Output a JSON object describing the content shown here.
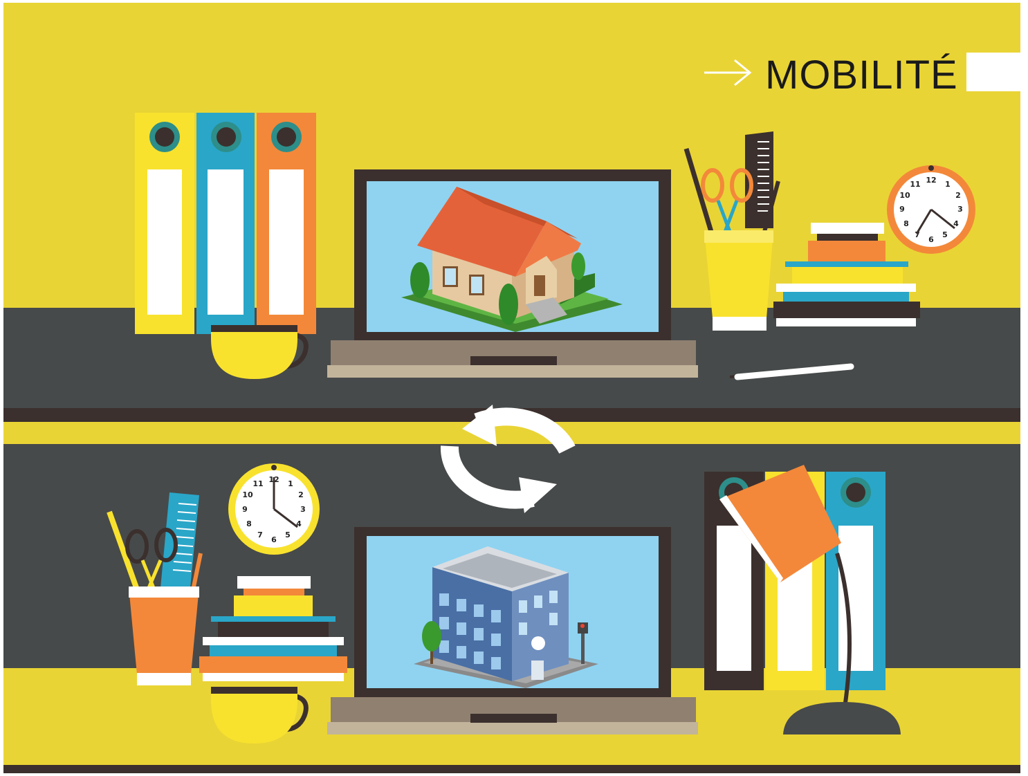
{
  "header": {
    "title": "MOBILITÉ",
    "arrow_icon": "arrow-right-icon"
  },
  "clocks": {
    "numbers": [
      "12",
      "1",
      "2",
      "3",
      "4",
      "5",
      "6",
      "7",
      "8",
      "9",
      "10",
      "11"
    ]
  },
  "colors": {
    "background_yellow": "#e9d435",
    "desk_gray": "#474a4a",
    "desk_dark": "#3b302d",
    "binder_yellow": "#f8e22e",
    "binder_blue": "#2aa6c8",
    "binder_orange": "#f3883a",
    "screen_blue": "#8fd3f1",
    "laptop_body": "#b6aa94",
    "white": "#ffffff"
  },
  "icons": {
    "sync": "sync-arrows-icon",
    "house": "house-icon",
    "office": "office-building-icon",
    "clock": "clock-icon",
    "lamp": "desk-lamp-icon"
  }
}
